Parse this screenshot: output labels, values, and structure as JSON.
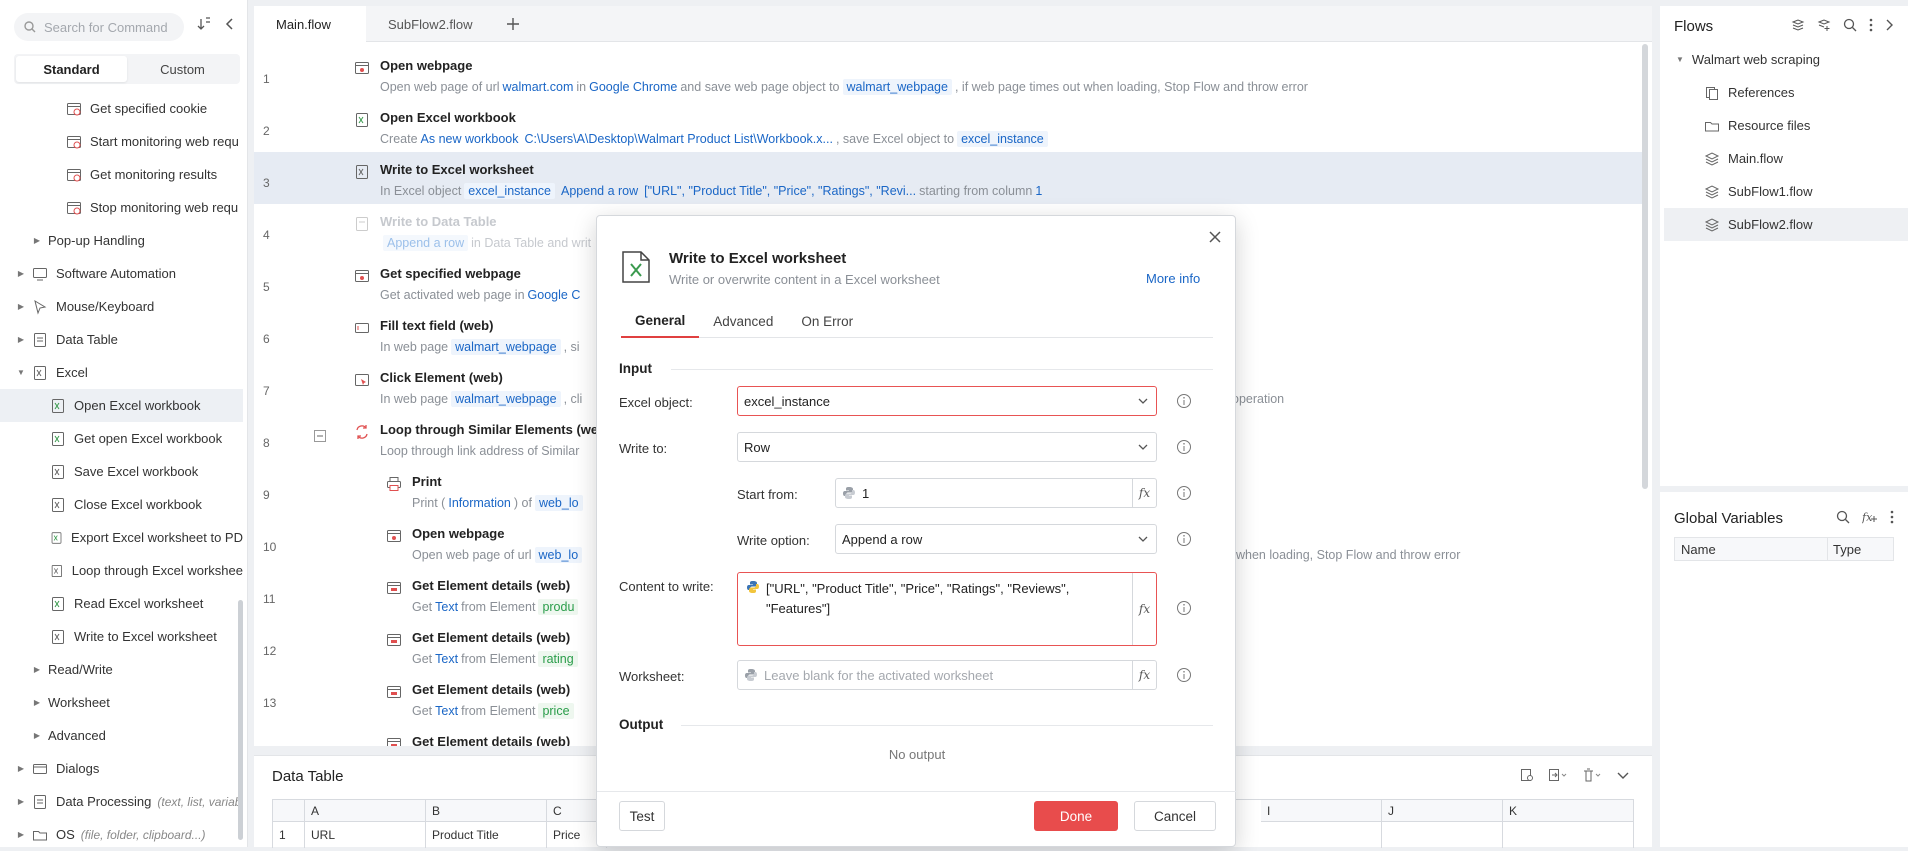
{
  "left_panel": {
    "search_placeholder": "Search for Command",
    "segments": [
      "Standard",
      "Custom"
    ],
    "items": [
      {
        "label": "Get specified cookie",
        "note": ""
      },
      {
        "label": "Start monitoring web requ",
        "note": ""
      },
      {
        "label": "Get monitoring results",
        "note": ""
      },
      {
        "label": "Stop monitoring web requ",
        "note": ""
      },
      {
        "label": "Pop-up Handling",
        "note": ""
      },
      {
        "label": "Software Automation",
        "note": ""
      },
      {
        "label": "Mouse/Keyboard",
        "note": ""
      },
      {
        "label": "Data Table",
        "note": ""
      },
      {
        "label": "Excel",
        "note": ""
      },
      {
        "label": "Open Excel workbook",
        "note": ""
      },
      {
        "label": "Get open Excel workbook",
        "note": ""
      },
      {
        "label": "Save Excel workbook",
        "note": ""
      },
      {
        "label": "Close Excel workbook",
        "note": ""
      },
      {
        "label": "Export Excel worksheet to PD",
        "note": ""
      },
      {
        "label": "Loop through Excel workshee",
        "note": ""
      },
      {
        "label": "Read Excel worksheet",
        "note": ""
      },
      {
        "label": "Write to Excel worksheet",
        "note": ""
      },
      {
        "label": "Read/Write",
        "note": ""
      },
      {
        "label": "Worksheet",
        "note": ""
      },
      {
        "label": "Advanced",
        "note": ""
      },
      {
        "label": "Dialogs",
        "note": ""
      },
      {
        "label": "Data Processing",
        "note": "(text, list, variab"
      },
      {
        "label": "OS",
        "note": "(file, folder, clipboard...)"
      }
    ]
  },
  "tabs": [
    "Main.flow",
    "SubFlow2.flow"
  ],
  "steps": [
    {
      "num": "1",
      "title": "Open webpage",
      "d": [
        "Open web page of url",
        "walmart.com",
        "in",
        "Google Chrome",
        "and save web page object to",
        "walmart_webpage",
        ", if web page times out when loading, Stop Flow and throw error"
      ]
    },
    {
      "num": "2",
      "title": "Open Excel workbook",
      "d": [
        "Create",
        "As new workbook",
        "C:\\Users\\A\\Desktop\\Walmart Product List\\Workbook.x...",
        ", save Excel object to",
        "excel_instance"
      ]
    },
    {
      "num": "3",
      "title": "Write to Excel worksheet",
      "d": [
        "In Excel object",
        "excel_instance",
        "Append a row",
        "[\"URL\", \"Product Title\", \"Price\", \"Ratings\", \"Revi...",
        "starting from column",
        "1"
      ]
    },
    {
      "num": "4",
      "title": "Write to Data Table",
      "d": [
        "Append a row",
        "in Data Table and writ"
      ]
    },
    {
      "num": "5",
      "title": "Get specified webpage",
      "d": [
        "Get activated web page in",
        "Google C"
      ]
    },
    {
      "num": "6",
      "title": "Fill text field (web)",
      "d": [
        "In web page",
        "walmart_webpage",
        ", si"
      ]
    },
    {
      "num": "7",
      "title": "Click Element (web)",
      "d": [
        "In web page",
        "walmart_webpage",
        ", cli",
        "operation"
      ]
    },
    {
      "num": "8",
      "title": "Loop through Similar Elements (we",
      "d": [
        "Loop through link address of Similar"
      ]
    },
    {
      "num": "9",
      "title": "Print",
      "d": [
        "Print (",
        "Information",
        ") of",
        "web_lo"
      ]
    },
    {
      "num": "10",
      "title": "Open webpage",
      "d": [
        "Open web page of url",
        "web_lo",
        "when loading, Stop Flow and throw error"
      ]
    },
    {
      "num": "11",
      "title": "Get Element details (web)",
      "d": [
        "Get",
        "Text",
        "from Element",
        "produ"
      ]
    },
    {
      "num": "12",
      "title": "Get Element details (web)",
      "d": [
        "Get",
        "Text",
        "from Element",
        "rating"
      ]
    },
    {
      "num": "13",
      "title": "Get Element details (web)",
      "d": [
        "Get",
        "Text",
        "from Element",
        "price"
      ]
    },
    {
      "num": "",
      "title": "Get Element details (web)",
      "d": []
    }
  ],
  "data_table": {
    "title": "Data Table",
    "columns": [
      "A",
      "B",
      "C",
      "I",
      "J",
      "K"
    ],
    "row_num": "1",
    "row_values": [
      "URL",
      "Product Title",
      "Price"
    ]
  },
  "flows": {
    "title": "Flows",
    "root": "Walmart web scraping",
    "items": [
      "References",
      "Resource files",
      "Main.flow",
      "SubFlow1.flow",
      "SubFlow2.flow"
    ]
  },
  "global_vars": {
    "title": "Global Variables",
    "col_name": "Name",
    "col_type": "Type"
  },
  "modal": {
    "title": "Write to Excel worksheet",
    "subtitle": "Write or overwrite content in a Excel worksheet",
    "more_info": "More info",
    "tabs": [
      "General",
      "Advanced",
      "On Error"
    ],
    "input_section": "Input",
    "excel_object_label": "Excel object:",
    "excel_object_value": "excel_instance",
    "write_to_label": "Write to:",
    "write_to_value": "Row",
    "start_from_label": "Start from:",
    "start_from_value": "1",
    "write_option_label": "Write option:",
    "write_option_value": "Append a row",
    "content_label": "Content to write:",
    "content_value": "[\"URL\", \"Product Title\", \"Price\", \"Ratings\", \"Reviews\", \"Features\"]",
    "worksheet_label": "Worksheet:",
    "worksheet_placeholder": "Leave blank for the activated worksheet",
    "fx": "fx",
    "output_section": "Output",
    "no_output": "No output",
    "test_btn": "Test",
    "done_btn": "Done",
    "cancel_btn": "Cancel"
  },
  "colors": {
    "accent": "#e84c4c",
    "link": "#1a66c6",
    "selected": "#e6ebf3"
  }
}
